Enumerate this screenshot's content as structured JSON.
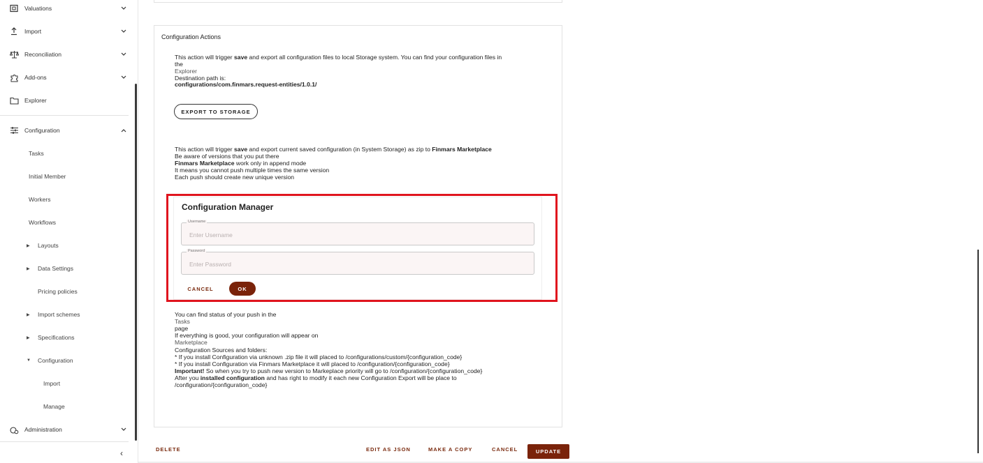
{
  "sidebar": {
    "top_items": [
      {
        "label": "Valuations",
        "icon": "valuations-icon"
      },
      {
        "label": "Import",
        "icon": "import-icon"
      },
      {
        "label": "Reconciliation",
        "icon": "reconciliation-icon"
      },
      {
        "label": "Add-ons",
        "icon": "addons-icon"
      },
      {
        "label": "Explorer",
        "icon": "folder-icon"
      },
      {
        "label": "Configuration",
        "icon": "sliders-icon"
      }
    ],
    "config_children": [
      {
        "label": "Tasks"
      },
      {
        "label": "Initial Member"
      },
      {
        "label": "Workers"
      },
      {
        "label": "Workflows"
      },
      {
        "label": "Layouts"
      },
      {
        "label": "Data Settings"
      },
      {
        "label": "Pricing policies"
      },
      {
        "label": "Import schemes"
      },
      {
        "label": "Specifications"
      },
      {
        "label": "Configuration"
      },
      {
        "label": "Import"
      },
      {
        "label": "Manage"
      }
    ],
    "administration": {
      "label": "Administration",
      "icon": "administration-icon"
    },
    "collapse_glyph": "‹"
  },
  "main": {
    "section_title": "Configuration Actions",
    "export": {
      "line1_pre": "This action will trigger ",
      "line1_bold": "save",
      "line1_post": " and export all configuration files to local Storage system. You can find your configuration files in",
      "line2": "the",
      "explorer_link": "Explorer",
      "dest_label": "Destination path is:",
      "dest_path": "configurations/com.finmars.request-entities/1.0.1/",
      "button": "EXPORT TO STORAGE"
    },
    "push": {
      "line1_pre": "This action will trigger ",
      "line1_bold": "save",
      "line1_mid": " and export current saved configuration (in System Storage) as zip to ",
      "line1_bold2": "Finmars Marketplace",
      "line2": "Be aware of versions that you put there",
      "line3_bold": "Finmars Marketplace",
      "line3_post": " work only in append mode",
      "line4": "It means you cannot push multiple times the same version",
      "line5": "Each push should create new unique version"
    },
    "manager": {
      "title": "Configuration Manager",
      "username_label": "Username",
      "username_placeholder": "Enter Username",
      "password_label": "Password",
      "password_placeholder": "Enter Password",
      "cancel": "CANCEL",
      "ok": "OK"
    },
    "status": {
      "l1": "You can find status of your push in the",
      "l2": "Tasks",
      "l3": "page",
      "l4": "If everything is good, your configuration will appear on",
      "l5": "Marketplace",
      "l6": "Configuration Sources and folders:",
      "l7": "* If you install Configuration via unknown .zip file it will placed to /configurations/custom/{configuration_code}",
      "l8": "* If you install Configuration via Finmars Marketplace it will placed to /configuration/{configuration_code}",
      "l9_bold": "Important!",
      "l9_post": " So when you try to push new version to Markeplace priority will go to /configuration/{configuration_code}",
      "l10_pre": "After you ",
      "l10_bold": "installed configuration",
      "l10_post": " and has right to modify it each new Configuration Export will be place to",
      "l11": "/configuration/{configuration_code}"
    }
  },
  "footer": {
    "delete": "DELETE",
    "edit_json": "EDIT AS JSON",
    "make_copy": "MAKE A COPY",
    "cancel": "CANCEL",
    "update": "UPDATE"
  },
  "colors": {
    "accent": "#7a230a",
    "highlight": "#e0141e"
  }
}
